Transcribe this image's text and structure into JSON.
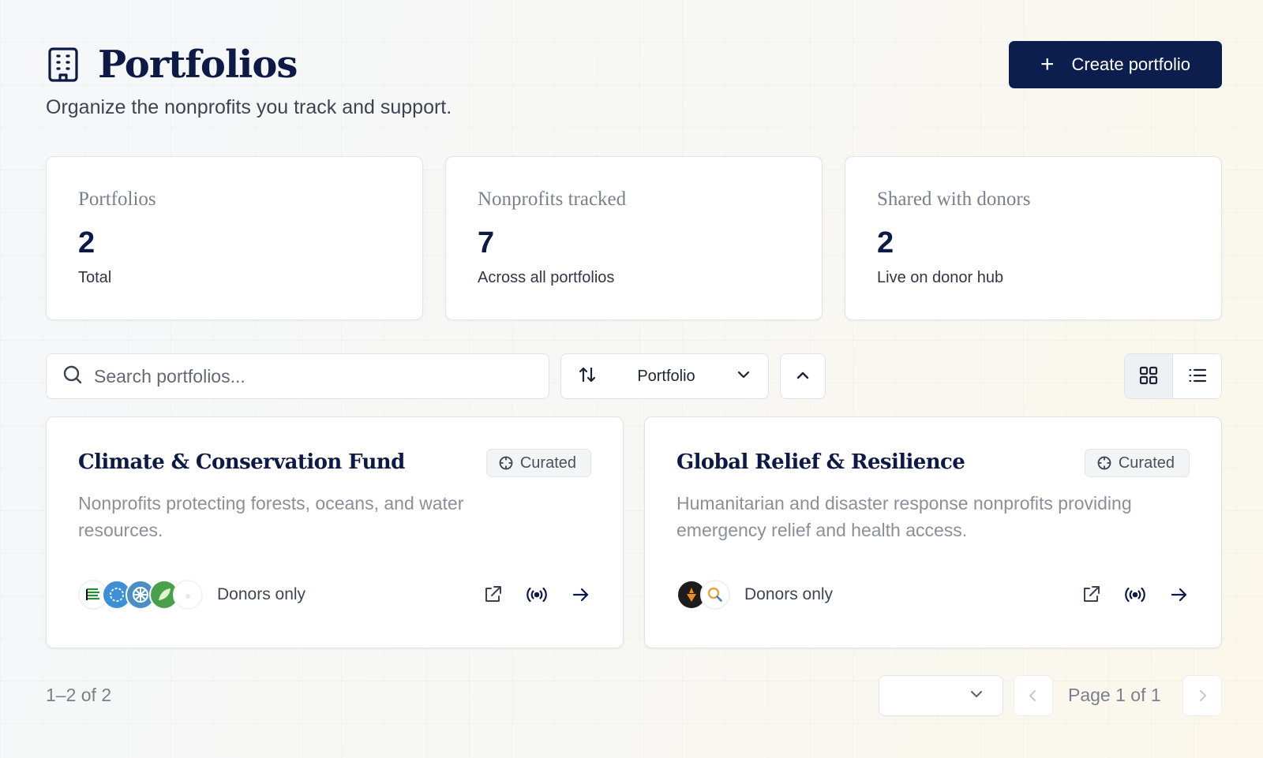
{
  "header": {
    "title": "Portfolios",
    "subtitle": "Organize the nonprofits you track and support.",
    "title_icon": "building-icon",
    "create_label": "Create portfolio",
    "create_icon": "plus-icon"
  },
  "stats": [
    {
      "label": "Portfolios",
      "value": "2",
      "note": "Total"
    },
    {
      "label": "Nonprofits tracked",
      "value": "7",
      "note": "Across all portfolios"
    },
    {
      "label": "Shared with donors",
      "value": "2",
      "note": "Live on donor hub"
    }
  ],
  "toolbar": {
    "search_placeholder": "Search portfolios...",
    "search_icon": "search-icon",
    "sort_icon": "sort-arrows-icon",
    "sort_value": "Portfolio",
    "sort_direction_icon": "chevron-up-icon",
    "view_grid_icon": "grid-icon",
    "view_list_icon": "list-icon",
    "active_view": "grid"
  },
  "portfolios": [
    {
      "name": "Climate & Conservation Fund",
      "badge": "Curated",
      "description": "Nonprofits protecting forests, oceans, and water resources.",
      "visibility": "Donors only",
      "avatars": [
        "#ffffff",
        "#3d8fd6",
        "#4a8fc4",
        "#49a04a",
        "#ffffff"
      ]
    },
    {
      "name": "Global Relief & Resilience",
      "badge": "Curated",
      "description": "Humanitarian and disaster response nonprofits providing emergency relief and health access.",
      "visibility": "Donors only",
      "avatars": [
        "#1d1d1d",
        "#ffffff"
      ]
    }
  ],
  "pagination": {
    "range": "1–2 of 2",
    "page_label": "Page 1 of 1",
    "page_size_value": ""
  },
  "colors": {
    "primary": "#0b1e4d",
    "text": "#0c1a45",
    "muted": "#7a808c"
  }
}
